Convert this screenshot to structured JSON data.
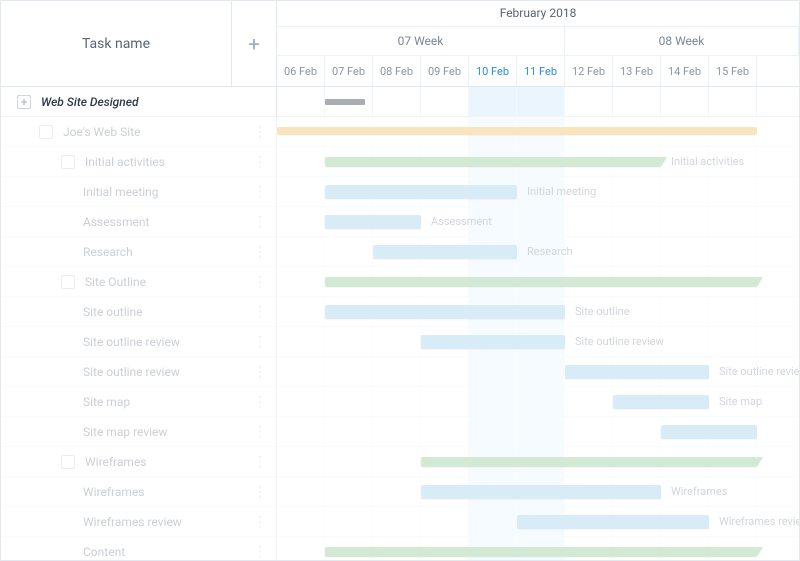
{
  "header": {
    "task_name": "Task name",
    "month": "February 2018",
    "weeks": [
      "07 Week",
      "08 Week"
    ],
    "days": [
      "06 Feb",
      "07 Feb",
      "08 Feb",
      "09 Feb",
      "10 Feb",
      "11 Feb",
      "12 Feb",
      "13 Feb",
      "14 Feb",
      "15 Feb"
    ],
    "highlight_days": [
      "10 Feb",
      "11 Feb"
    ]
  },
  "tasks": [
    {
      "label": "Web Site Designed",
      "indent": 0,
      "bold": true,
      "expand": true
    },
    {
      "label": "Joe's Web Site",
      "indent": 1,
      "chk": true,
      "menu": true
    },
    {
      "label": "Initial activities",
      "indent": 2,
      "chk": true,
      "menu": true,
      "bar_label": "Initial activities"
    },
    {
      "label": "Initial meeting",
      "indent": 3,
      "menu": true,
      "bar_label": "Initial meeting"
    },
    {
      "label": "Assessment",
      "indent": 3,
      "menu": true,
      "bar_label": "Assessment"
    },
    {
      "label": "Research",
      "indent": 3,
      "menu": true,
      "bar_label": "Research"
    },
    {
      "label": "Site Outline",
      "indent": 2,
      "chk": true,
      "menu": true
    },
    {
      "label": "Site outline",
      "indent": 3,
      "menu": true,
      "bar_label": "Site outline"
    },
    {
      "label": "Site outline review",
      "indent": 3,
      "menu": true,
      "bar_label": "Site outline review"
    },
    {
      "label": "Site outline review",
      "indent": 3,
      "menu": true,
      "bar_label": "Site outline review"
    },
    {
      "label": "Site map",
      "indent": 3,
      "menu": true,
      "bar_label": "Site map"
    },
    {
      "label": "Site map review",
      "indent": 3,
      "menu": true
    },
    {
      "label": "Wireframes",
      "indent": 2,
      "chk": true,
      "menu": true
    },
    {
      "label": "Wireframes",
      "indent": 3,
      "menu": true,
      "bar_label": "Wireframes"
    },
    {
      "label": "Wireframes review",
      "indent": 3,
      "menu": true,
      "bar_label": "Wireframes review"
    },
    {
      "label": "Content",
      "indent": 3,
      "menu": true
    }
  ],
  "chart_data": {
    "type": "gantt",
    "x_unit": "day",
    "x_range": [
      "2018-02-06",
      "2018-02-15"
    ],
    "series": [
      {
        "name": "Web Site Designed",
        "kind": "milestone",
        "start": "2018-02-07",
        "end": "2018-02-07"
      },
      {
        "name": "Joe's Web Site",
        "kind": "summary",
        "color": "orange",
        "start": "2018-02-06",
        "end": "2018-02-15"
      },
      {
        "name": "Initial activities",
        "kind": "summary",
        "color": "green",
        "start": "2018-02-07",
        "end": "2018-02-13"
      },
      {
        "name": "Initial meeting",
        "kind": "task",
        "color": "blue",
        "start": "2018-02-07",
        "end": "2018-02-10"
      },
      {
        "name": "Assessment",
        "kind": "task",
        "color": "blue",
        "start": "2018-02-07",
        "end": "2018-02-08"
      },
      {
        "name": "Research",
        "kind": "task",
        "color": "blue",
        "start": "2018-02-08",
        "end": "2018-02-10"
      },
      {
        "name": "Site Outline",
        "kind": "summary",
        "color": "green",
        "start": "2018-02-07",
        "end": "2018-02-15"
      },
      {
        "name": "Site outline",
        "kind": "task",
        "color": "blue",
        "start": "2018-02-07",
        "end": "2018-02-11"
      },
      {
        "name": "Site outline review",
        "kind": "task",
        "color": "blue",
        "start": "2018-02-09",
        "end": "2018-02-11"
      },
      {
        "name": "Site outline review",
        "kind": "task",
        "color": "blue",
        "start": "2018-02-12",
        "end": "2018-02-14"
      },
      {
        "name": "Site map",
        "kind": "task",
        "color": "blue",
        "start": "2018-02-13",
        "end": "2018-02-14"
      },
      {
        "name": "Site map review",
        "kind": "task",
        "color": "blue",
        "start": "2018-02-14",
        "end": "2018-02-15"
      },
      {
        "name": "Wireframes",
        "kind": "summary",
        "color": "green",
        "start": "2018-02-09",
        "end": "2018-02-15"
      },
      {
        "name": "Wireframes",
        "kind": "task",
        "color": "blue",
        "start": "2018-02-09",
        "end": "2018-02-13"
      },
      {
        "name": "Wireframes review",
        "kind": "task",
        "color": "blue",
        "start": "2018-02-11",
        "end": "2018-02-14"
      },
      {
        "name": "Content",
        "kind": "summary",
        "color": "green",
        "start": "2018-02-07",
        "end": "2018-02-15"
      }
    ]
  }
}
